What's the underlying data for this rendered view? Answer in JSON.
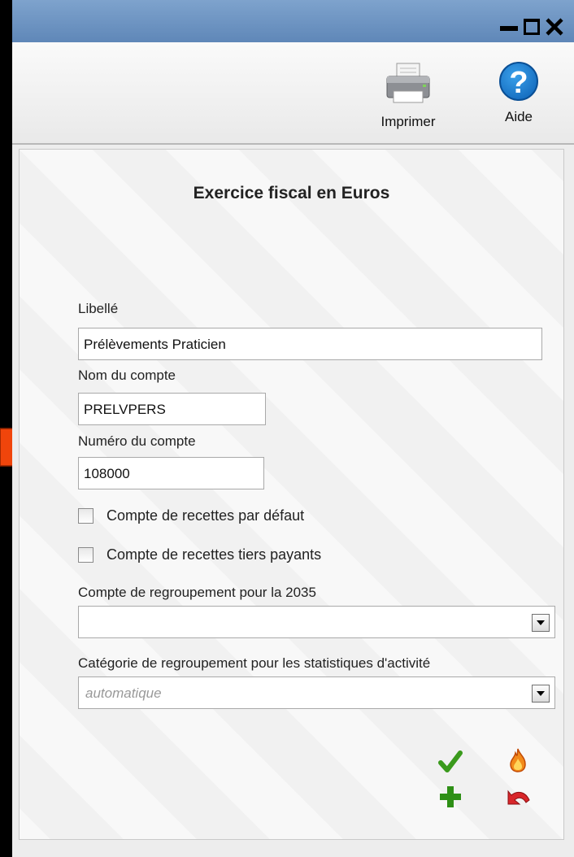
{
  "window": {
    "controls": [
      "minimize",
      "maximize",
      "close"
    ]
  },
  "toolbar": {
    "print_label": "Imprimer",
    "help_label": "Aide",
    "help_glyph": "?"
  },
  "form": {
    "title": "Exercice fiscal en Euros",
    "libelle_label": "Libellé",
    "libelle_value": "Prélèvements Praticien",
    "nom_label": "Nom du compte",
    "nom_value": "PRELVPERS",
    "numero_label": "Numéro du compte",
    "numero_value": "108000",
    "cb_recettes_label": "Compte de recettes par défaut",
    "cb_recettes_checked": false,
    "cb_tiers_label": "Compte de recettes tiers payants",
    "cb_tiers_checked": false,
    "regroupement_label": "Compte de regroupement pour la 2035",
    "regroupement_value": "",
    "categorie_label": "Catégorie de regroupement pour les statistiques d'activité",
    "categorie_placeholder": "automatique"
  },
  "actions": [
    "validate-icon",
    "delete-icon",
    "add-icon",
    "undo-icon"
  ],
  "colors": {
    "titlebar": "#6b92c2",
    "arrow": "#f0450b",
    "validate": "#3a9a1c",
    "add": "#2e8f16",
    "undo": "#d8262a"
  }
}
